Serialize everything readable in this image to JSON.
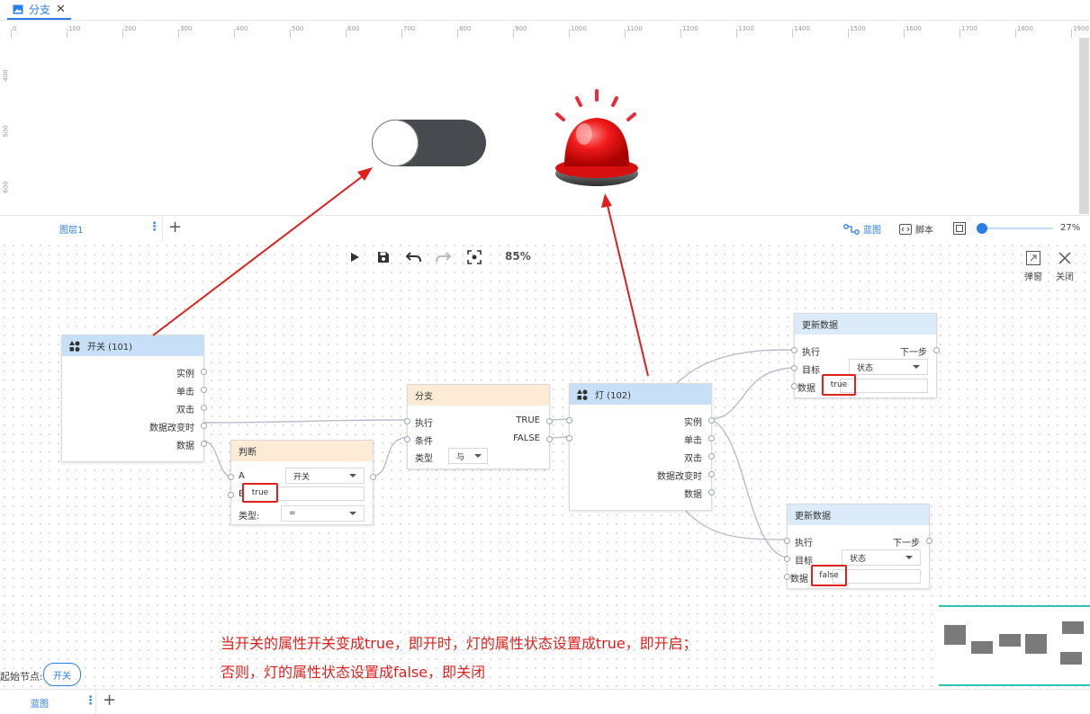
{
  "tab": {
    "title": "分支",
    "close": "✕"
  },
  "ruler": {
    "top_labels": [
      "0",
      "100",
      "200",
      "300",
      "400",
      "500",
      "600",
      "700",
      "800",
      "900",
      "1000",
      "1100",
      "1200",
      "1300",
      "1400",
      "1500",
      "1600",
      "1700",
      "1800",
      "1900"
    ],
    "left_labels": [
      "400",
      "500",
      "600"
    ]
  },
  "layer_bar": {
    "layer_tab": "图层1",
    "more": "⋮",
    "add": "+",
    "blueprint": "蓝图",
    "script": "脚本",
    "zoom_percent": "27%",
    "zoom_level": 0.27
  },
  "toolbar": {
    "zoom": "85%"
  },
  "side_buttons": {
    "popup": "弹窗",
    "close": "关闭"
  },
  "nodes": {
    "switch": {
      "title": "开关 (101)",
      "outputs": [
        "实例",
        "单击",
        "双击",
        "数据改变时",
        "数据"
      ]
    },
    "judge": {
      "title": "判断",
      "a_label": "A",
      "a_value": "开关",
      "b_label": "B",
      "b_value": "true",
      "type_label": "类型:",
      "type_value": "="
    },
    "branch": {
      "title": "分支",
      "exec": "执行",
      "cond": "条件",
      "type_label": "类型",
      "type_value": "与",
      "true_out": "TRUE",
      "false_out": "FALSE"
    },
    "light": {
      "title": "灯 (102)",
      "outputs": [
        "实例",
        "单击",
        "双击",
        "数据改变时",
        "数据"
      ]
    },
    "update1": {
      "title": "更新数据",
      "exec": "执行",
      "next": "下一步",
      "target": "目标",
      "target_value": "状态",
      "data": "数据",
      "data_value": "true"
    },
    "update2": {
      "title": "更新数据",
      "exec": "执行",
      "next": "下一步",
      "target": "目标",
      "target_value": "状态",
      "data": "数据",
      "data_value": "false"
    }
  },
  "note": {
    "line1": "当开关的属性开关变成true，即开时，灯的属性状态设置成true，即开启；",
    "line2": "否则，灯的属性状态设置成false，即关闭"
  },
  "start_node": {
    "label": "起始节点:",
    "value": "开关"
  },
  "bottom_bar": {
    "tab": "蓝图",
    "more": "⋮",
    "add": "+"
  },
  "colors": {
    "accent": "#2b7de9",
    "annotation": "#e0201c",
    "toggle_track": "#474a4f",
    "alarm": "#ee1111"
  }
}
